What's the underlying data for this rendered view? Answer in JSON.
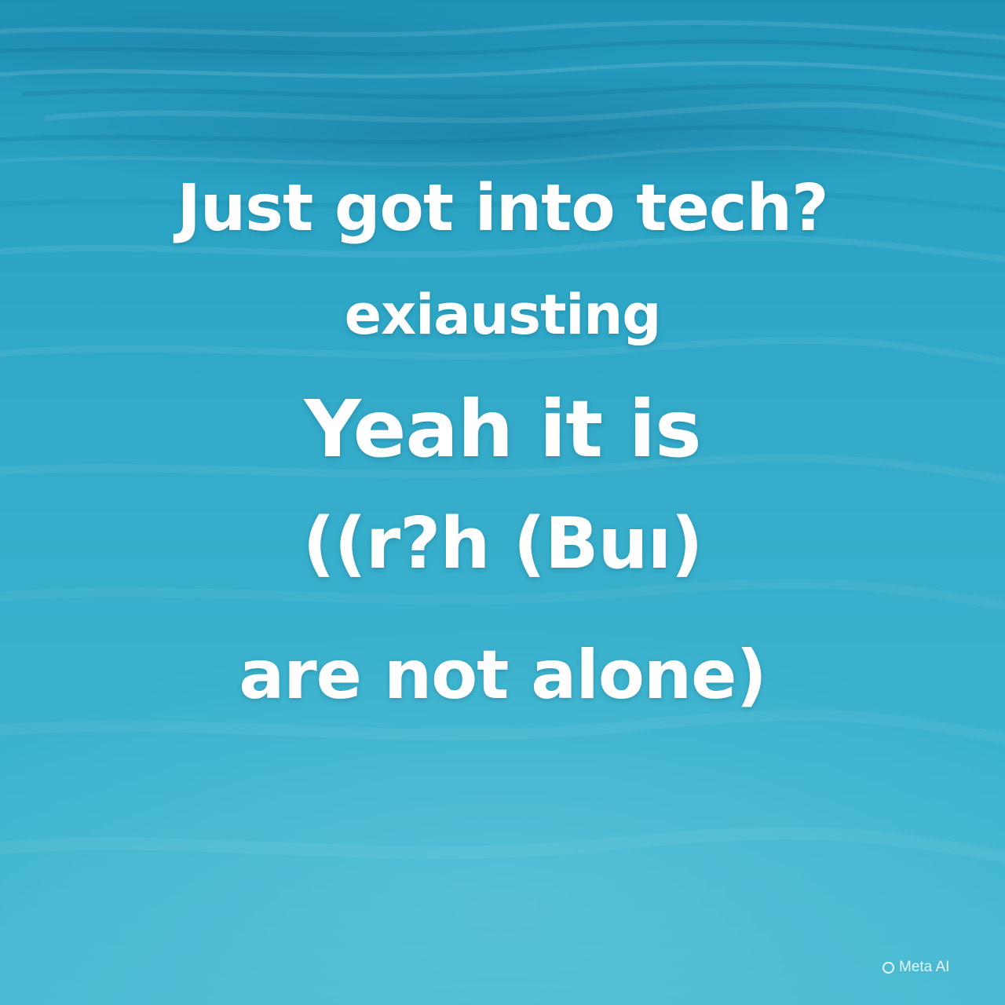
{
  "image": {
    "background_color": "#34abc9",
    "text_color": "#ffffff"
  },
  "caption": {
    "line1": "Just got into tech?",
    "line2": "exiausting",
    "line3": "Yeah it is",
    "line4": "((r?h (Buı)",
    "line5": "are not alone)"
  },
  "watermark": {
    "icon": "meta-ai-ring-icon",
    "text": "Meta AI"
  }
}
